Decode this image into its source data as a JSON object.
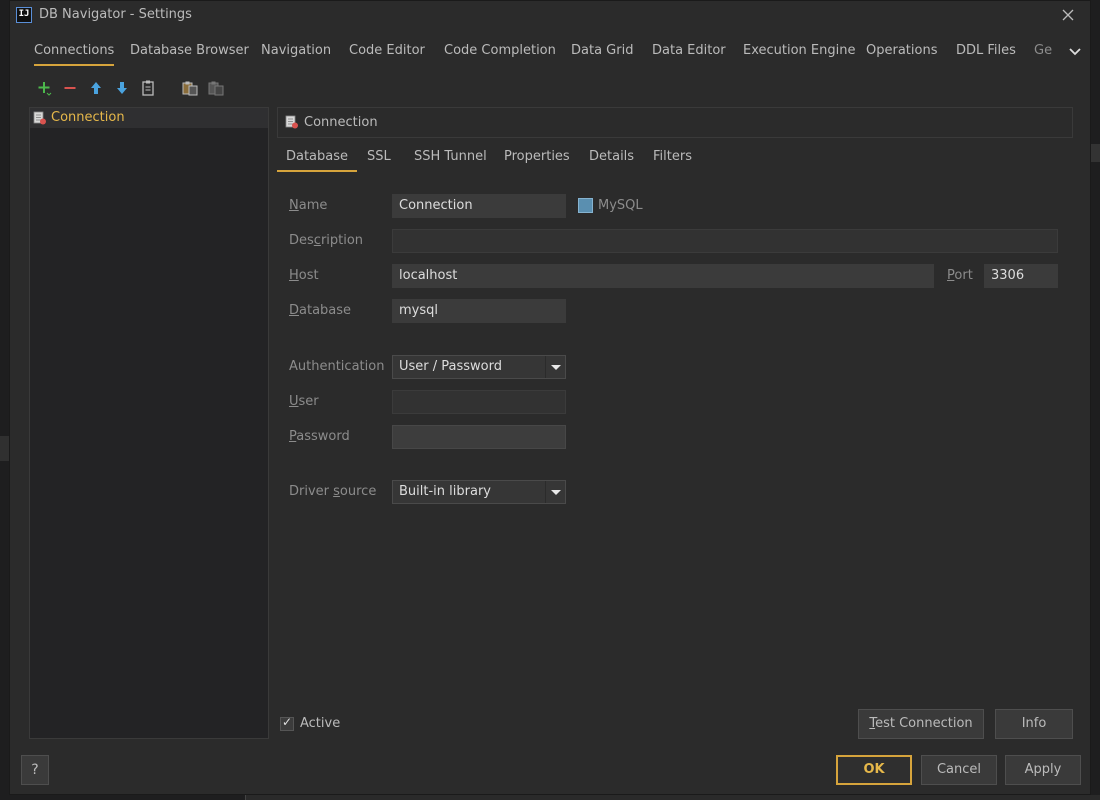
{
  "window": {
    "title": "DB Navigator - Settings",
    "logo_text": "IJ"
  },
  "top_tabs": [
    {
      "label": "Connections",
      "active": true
    },
    {
      "label": "Database Browser"
    },
    {
      "label": "Navigation"
    },
    {
      "label": "Code Editor"
    },
    {
      "label": "Code Completion"
    },
    {
      "label": "Data Grid"
    },
    {
      "label": "Data Editor"
    },
    {
      "label": "Execution Engine"
    },
    {
      "label": "Operations"
    },
    {
      "label": "DDL Files"
    },
    {
      "label": "Ge"
    }
  ],
  "toolbar": {
    "buttons": [
      "add-icon",
      "remove-icon",
      "move-up-icon",
      "move-down-icon",
      "copy-icon",
      "paste-icon",
      "paste-disabled-icon"
    ]
  },
  "tree": {
    "items": [
      {
        "label": "Connection"
      }
    ]
  },
  "connection_header": {
    "label": "Connection"
  },
  "sub_tabs": [
    {
      "label": "Database",
      "active": true
    },
    {
      "label": "SSL"
    },
    {
      "label": "SSH Tunnel"
    },
    {
      "label": "Properties"
    },
    {
      "label": "Details"
    },
    {
      "label": "Filters"
    }
  ],
  "form": {
    "name_label_mnemonic": "N",
    "name_label_rest": "ame",
    "name_value": "Connection",
    "db_type": "MySQL",
    "description_label_pre": "Des",
    "description_label_mnemonic": "c",
    "description_label_rest": "ription",
    "description_value": "",
    "host_label_mnemonic": "H",
    "host_label_rest": "ost",
    "host_value": "localhost",
    "port_label_mnemonic": "P",
    "port_label_rest": "ort",
    "port_value": "3306",
    "database_label_mnemonic": "D",
    "database_label_rest": "atabase",
    "database_value": "mysql",
    "authentication_label": "Authentication",
    "authentication_value": "User / Password",
    "user_label_mnemonic": "U",
    "user_label_rest": "ser",
    "user_value": "",
    "password_label_mnemonic": "P",
    "password_label_rest": "assword",
    "password_value": "",
    "driver_label_pre": "Driver ",
    "driver_label_mnemonic": "s",
    "driver_label_rest": "ource",
    "driver_value": "Built-in library"
  },
  "bottom": {
    "active_label": "Active",
    "active_checked": true,
    "test_connection_mnemonic": "T",
    "test_connection_rest": "est Connection",
    "info_label": "Info",
    "help_label": "?",
    "ok_label": "OK",
    "cancel_label": "Cancel",
    "apply_label": "Apply"
  },
  "colors": {
    "accent": "#d6a43c",
    "background": "#2b2b2b",
    "tree_selection_text": "#e6b84a"
  }
}
